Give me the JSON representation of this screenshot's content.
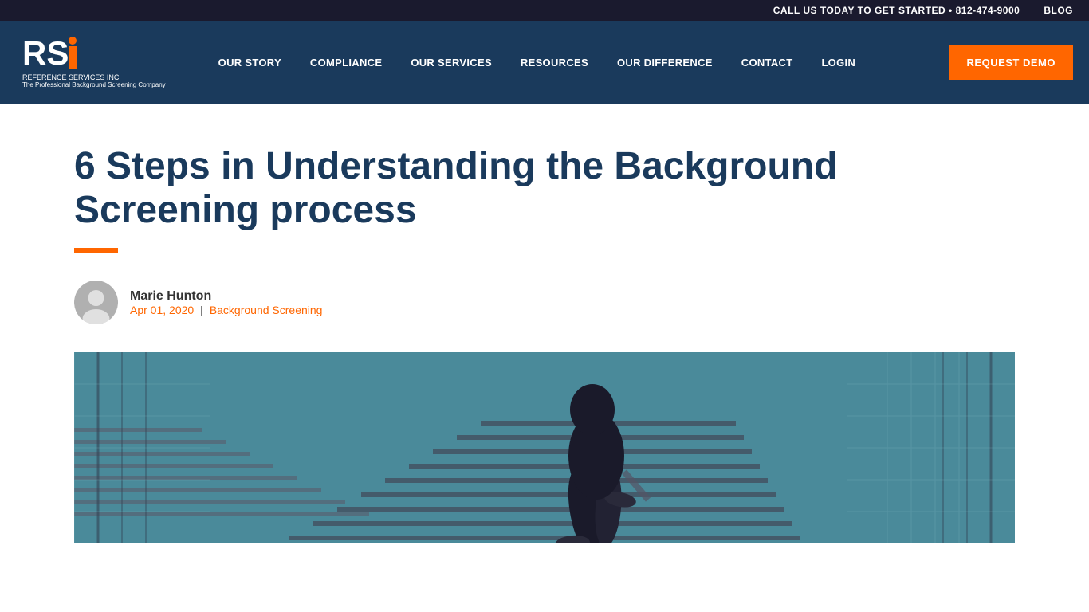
{
  "topbar": {
    "call_text": "CALL US TODAY TO GET STARTED • 812-474-9000",
    "blog_label": "BLOG"
  },
  "navbar": {
    "logo_company": "RSI",
    "logo_r": "R",
    "logo_s": "S",
    "logo_tagline": "REFERENCE SERVICES INC",
    "logo_tagline2": "The Professional Background Screening Company",
    "nav_items": [
      {
        "label": "OUR STORY"
      },
      {
        "label": "COMPLIANCE"
      },
      {
        "label": "OUR SERVICES"
      },
      {
        "label": "RESOURCES"
      },
      {
        "label": "OUR DIFFERENCE"
      },
      {
        "label": "CONTACT"
      },
      {
        "label": "LOGIN"
      }
    ],
    "cta_label": "REQUEST DEMO"
  },
  "article": {
    "title": "6 Steps in Understanding the Background Screening process",
    "author_name": "Marie Hunton",
    "author_date": "Apr 01, 2020",
    "separator": "|",
    "category": "Background Screening"
  }
}
